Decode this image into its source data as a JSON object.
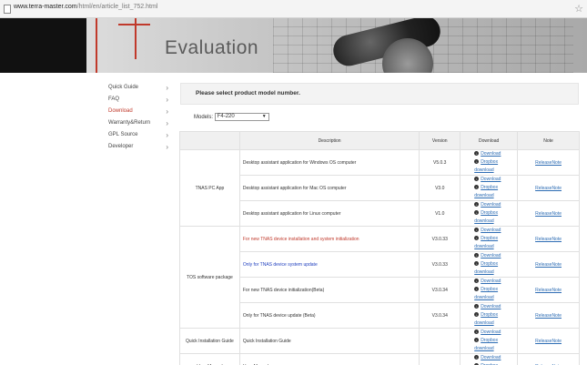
{
  "browser": {
    "url_domain": "www.terra-master.com",
    "url_path": "/html/en/article_list_752.html"
  },
  "banner": {
    "title": "Evaluation"
  },
  "sidebar": {
    "items": [
      {
        "label": "Quick Guide"
      },
      {
        "label": "FAQ"
      },
      {
        "label": "Download",
        "active": true
      },
      {
        "label": "Warranty&Return"
      },
      {
        "label": "GPL Source"
      },
      {
        "label": "Developer"
      }
    ]
  },
  "main": {
    "prompt": "Please select product model number.",
    "model_label": "Models:",
    "model_value": "F4-220"
  },
  "table": {
    "headers": [
      "",
      "Description",
      "Version",
      "Download",
      "Note"
    ],
    "download_label": "Download",
    "dropbox_label": "Dropbox download",
    "note_label": "ReleaseNote",
    "groups": [
      {
        "category": "TNAS PC App",
        "rows": [
          {
            "desc": "Desktop assistant application for Windows OS computer",
            "version": "V5.0.3",
            "color": "normal"
          },
          {
            "desc": "Desktop assistant application for Mac OS computer",
            "version": "V3.0",
            "color": "normal"
          },
          {
            "desc": "Desktop assistant application for Linux computer",
            "version": "V1.0",
            "color": "normal"
          }
        ]
      },
      {
        "category": "TOS software package",
        "rows": [
          {
            "desc": "For new TNAS device installation and system initialization",
            "version": "V3.0.33",
            "color": "red"
          },
          {
            "desc": "Only for TNAS device system update",
            "version": "V3.0.33",
            "color": "blue"
          },
          {
            "desc": "For new TNAS device initialization(Beta)",
            "version": "V3.0.34",
            "color": "normal"
          },
          {
            "desc": "Only for TNAS device update (Beta)",
            "version": "V3.0.34",
            "color": "normal"
          }
        ]
      },
      {
        "category": "Quick Installation Guide",
        "rows": [
          {
            "desc": "Quick Installation Guide",
            "version": "",
            "color": "normal"
          }
        ]
      },
      {
        "category": "User Manual",
        "rows": [
          {
            "desc": "User Manual",
            "version": "",
            "color": "normal"
          }
        ]
      }
    ]
  }
}
